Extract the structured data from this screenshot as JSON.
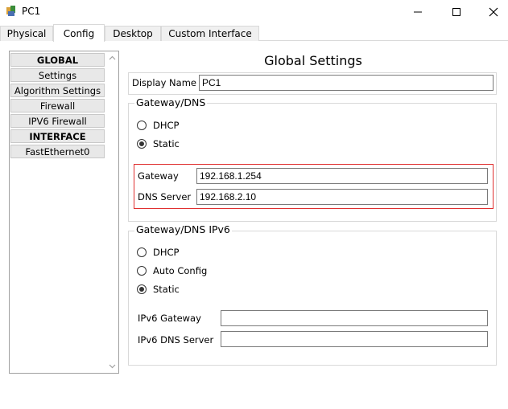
{
  "window": {
    "title": "PC1",
    "minimize": "—",
    "maximize": "☐",
    "close": "✕"
  },
  "tabs": [
    {
      "label": "Physical",
      "active": false
    },
    {
      "label": "Config",
      "active": true
    },
    {
      "label": "Desktop",
      "active": false
    },
    {
      "label": "Custom Interface",
      "active": false
    }
  ],
  "nav": {
    "items": [
      {
        "label": "GLOBAL",
        "header": true
      },
      {
        "label": "Settings",
        "header": false
      },
      {
        "label": "Algorithm Settings",
        "header": false
      },
      {
        "label": "Firewall",
        "header": false
      },
      {
        "label": "IPV6 Firewall",
        "header": false
      },
      {
        "label": "INTERFACE",
        "header": true
      },
      {
        "label": "FastEthernet0",
        "header": false
      }
    ]
  },
  "global": {
    "title": "Global Settings",
    "display_name_label": "Display Name",
    "display_name_value": "PC1"
  },
  "gateway_dns": {
    "legend": "Gateway/DNS",
    "dhcp_label": "DHCP",
    "static_label": "Static",
    "selected": "Static",
    "gateway_label": "Gateway",
    "gateway_value": "192.168.1.254",
    "dns_label": "DNS Server",
    "dns_value": "192.168.2.10",
    "highlight_color": "#e03030"
  },
  "gateway_dns_ipv6": {
    "legend": "Gateway/DNS IPv6",
    "dhcp_label": "DHCP",
    "auto_label": "Auto Config",
    "static_label": "Static",
    "selected": "Static",
    "ipv6_gateway_label": "IPv6 Gateway",
    "ipv6_gateway_value": "",
    "ipv6_dns_label": "IPv6 DNS Server",
    "ipv6_dns_value": ""
  }
}
